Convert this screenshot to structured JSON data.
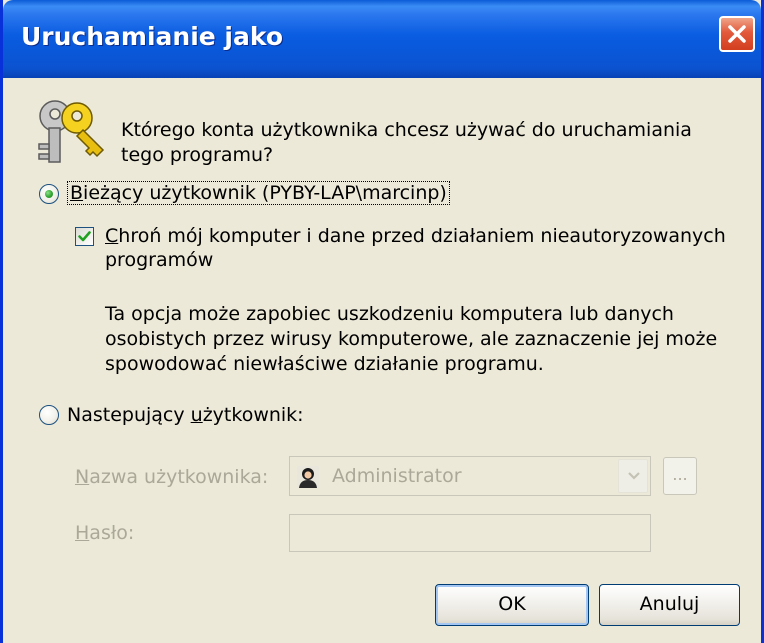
{
  "window": {
    "title": "Uruchamianie jako"
  },
  "question": {
    "line1": "Którego konta użytkownika chcesz używać do uruchamiania",
    "line2": "tego programu?"
  },
  "current_user": {
    "prefix_underlined": "B",
    "label_rest": "ieżący użytkownik (PYBY-LAP\\marcinp)",
    "selected": true
  },
  "protect": {
    "prefix_underlined": "C",
    "line1_rest": "hroń mój komputer i dane przed działaniem nieautoryzowanych",
    "line2": "programów",
    "checked": true
  },
  "description": {
    "line1": "Ta opcja może zapobiec uszkodzeniu komputera lub danych",
    "line2": "osobistych przez wirusy komputerowe, ale zaznaczenie jej może",
    "line3": "spowodować niewłaściwe działanie programu."
  },
  "other_user": {
    "label_before": "Nastepujący ",
    "label_underlined": "u",
    "label_after": "żytkownik:",
    "selected": false
  },
  "username": {
    "label_underlined": "N",
    "label_rest": "azwa użytkownika:",
    "value": "Administrator"
  },
  "browse": {
    "label": "..."
  },
  "password": {
    "label_underlined": "H",
    "label_rest": "asło:",
    "value": ""
  },
  "buttons": {
    "ok": "OK",
    "cancel": "Anuluj"
  },
  "colors": {
    "dialog_bg": "#ece9d8",
    "title_blue": "#0a57d8",
    "close_red": "#d23f1f",
    "disabled_text": "#aca899"
  },
  "icons": {
    "dialog": "keys-icon",
    "close": "close-icon",
    "user": "user-icon",
    "dropdown": "chevron-down-icon"
  }
}
